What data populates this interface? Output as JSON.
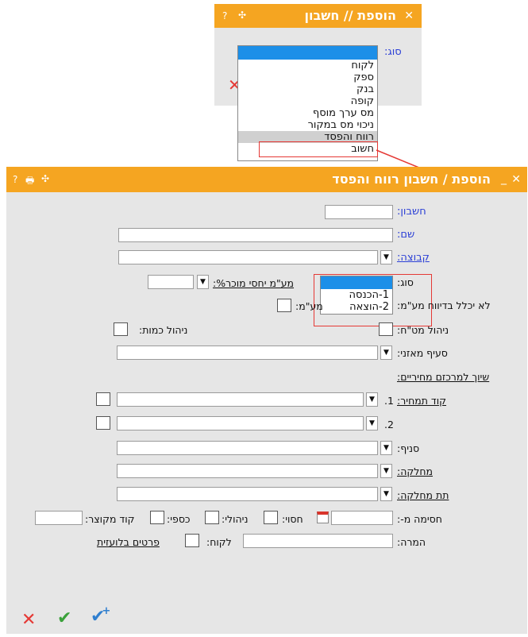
{
  "small_dialog": {
    "title": "הוספת // חשבון",
    "type_label": "סוג:",
    "options": [
      "לקוח",
      "ספק",
      "בנק",
      "קופה",
      "מס ערך מוסף",
      "ניכוי מס במקור",
      "רווח והפסד",
      "חשוב"
    ],
    "selected_option": "רווח והפסד"
  },
  "main_dialog": {
    "title": "הוספת / חשבון רווח והפסד",
    "fields": {
      "account": "חשבון:",
      "name": "שם:",
      "group": "קבוצה:",
      "type": "סוג:",
      "vat_sales": "מע\"מ יחסי מוכר%:",
      "no_vat_report": "לא יכלל בדיווח מע\"מ:",
      "vat_short": "מע\"מ:",
      "currency_mgmt": "ניהול מט\"ח:",
      "qty_mgmt": "ניהול כמות:",
      "balance_clause": "סעיף מאזני:",
      "price_link": "שיוך למרכזם מחיריים:",
      "price_code": "קוד תמחיר:",
      "row1": "1.",
      "row2": "2.",
      "branch": "סניף:",
      "department": "מחלקה:",
      "sub_department": "תת מחלקה:",
      "block_from": "חסימה מ-:",
      "secret": "חסוי:",
      "managerial": "ניהולי:",
      "financial": "כספי:",
      "short_code": "קוד מקוצר:",
      "remark": "המרה:",
      "customer": "לקוח:",
      "foreign_details": "פרטים בלועזית"
    },
    "type_dropdown": {
      "options": [
        "1-הכנסה",
        "2-הוצאה"
      ]
    }
  },
  "colors": {
    "titlebar": "#f5a521",
    "panel": "#e6e6e6",
    "highlight": "#1c8fe8",
    "label_blue": "#2b3fd6",
    "annotation_red": "#e53935"
  }
}
